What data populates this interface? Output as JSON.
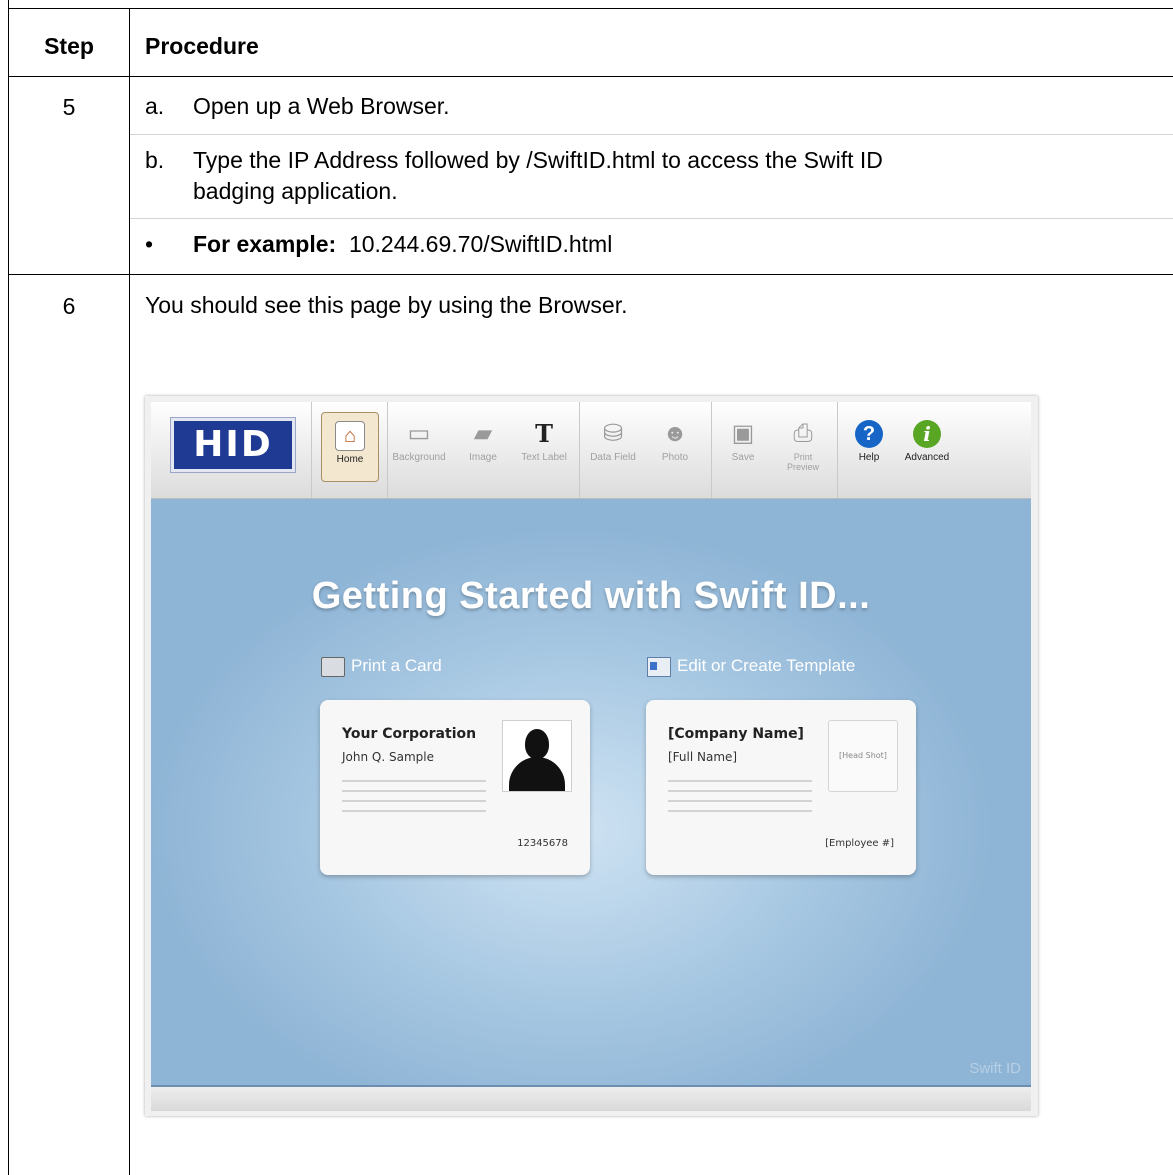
{
  "table": {
    "header": {
      "step": "Step",
      "procedure": "Procedure"
    },
    "row5": {
      "step": "5",
      "a_letter": "a.",
      "a_text": "Open up a Web Browser.",
      "b_letter": "b.",
      "b_text_line1": "Type the IP Address followed by /SwiftID.html to access the Swift ID",
      "b_text_line2": "badging application.",
      "bullet": "•",
      "example_label": "For example:",
      "example_value": "10.244.69.70/SwiftID.html"
    },
    "row6": {
      "step": "6",
      "text": "You should see this page by using the Browser."
    }
  },
  "app": {
    "logo": "HID",
    "toolbar": [
      {
        "label": "Home",
        "icon": "home-icon",
        "active": true
      },
      {
        "label": "Background",
        "icon": "background-icon"
      },
      {
        "label": "Image",
        "icon": "image-folder-icon"
      },
      {
        "label": "Text Label",
        "icon": "text-label-icon",
        "glyph": "T"
      },
      {
        "label": "Data Field",
        "icon": "database-icon"
      },
      {
        "label": "Photo",
        "icon": "photo-icon"
      },
      {
        "label": "Save",
        "icon": "save-icon"
      },
      {
        "label": "Print Preview",
        "icon": "printer-icon"
      },
      {
        "label": "Help",
        "icon": "help-icon",
        "glyph": "?"
      },
      {
        "label": "Advanced",
        "icon": "info-icon",
        "glyph": "i"
      }
    ],
    "title": "Getting Started with Swift ID...",
    "actions": {
      "print": "Print a Card",
      "edit": "Edit or Create Template"
    },
    "card_sample": {
      "org": "Your Corporation",
      "name": "John Q. Sample",
      "number": "12345678"
    },
    "card_template": {
      "org": "[Company Name]",
      "name": "[Full Name]",
      "photo_placeholder": "[Head Shot]",
      "number": "[Employee #]"
    },
    "watermark": "Swift ID",
    "colors": {
      "logo_bg": "#1f3a93",
      "canvas_bg": "#a9c9e3",
      "help_icon": "#1766c7",
      "advanced_icon": "#58a623"
    }
  }
}
